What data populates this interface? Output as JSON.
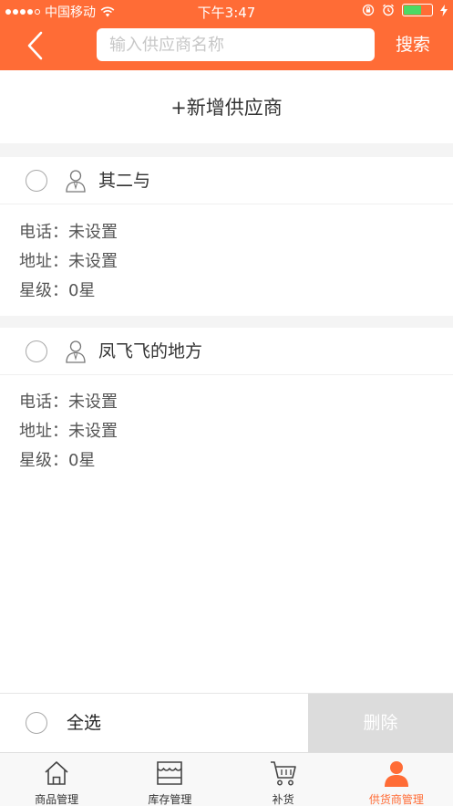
{
  "status_bar": {
    "carrier": "中国移动",
    "time": "下午3:47",
    "battery_color": "#4cd964"
  },
  "header": {
    "back_icon": "chevron-left-icon",
    "search_placeholder": "输入供应商名称",
    "search_label": "搜索",
    "accent_color": "#ff6c36"
  },
  "add_supplier_label": "+新增供应商",
  "suppliers": [
    {
      "name": "其二与",
      "phone": "电话：未设置",
      "address": "地址：未设置",
      "rating": "星级：0星"
    },
    {
      "name": "凤飞飞的地方",
      "phone": "电话：未设置",
      "address": "地址：未设置",
      "rating": "星级：0星"
    }
  ],
  "bottom_bar": {
    "select_all_label": "全选",
    "delete_label": "删除"
  },
  "tabs": [
    {
      "label": "商品管理",
      "icon": "home-icon",
      "active": false
    },
    {
      "label": "库存管理",
      "icon": "store-icon",
      "active": false
    },
    {
      "label": "补货",
      "icon": "cart-icon",
      "active": false
    },
    {
      "label": "供货商管理",
      "icon": "user-icon",
      "active": true
    }
  ]
}
